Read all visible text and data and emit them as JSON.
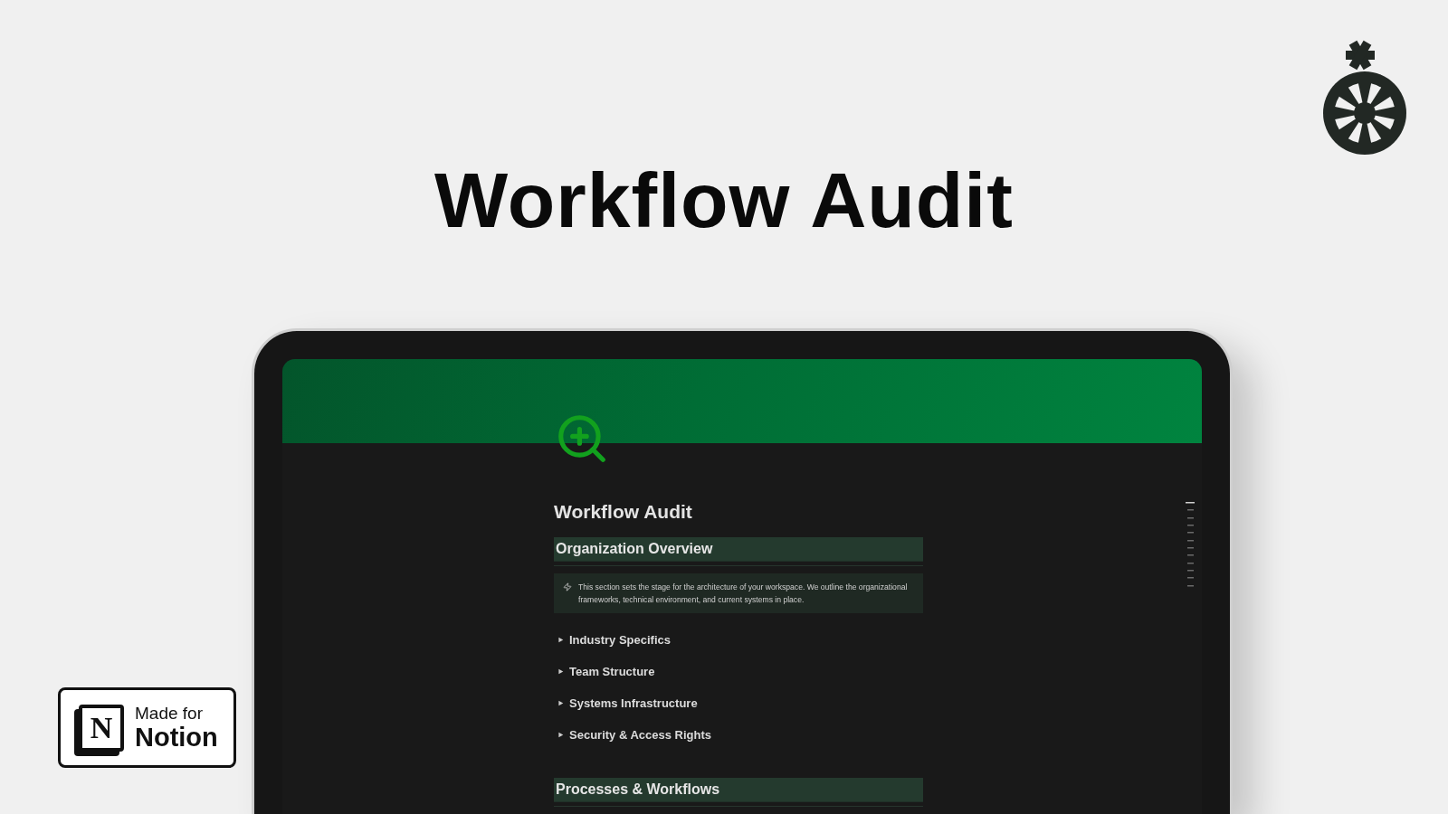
{
  "headline": "Workflow Audit",
  "page": {
    "title": "Workflow Audit",
    "sections": [
      {
        "heading": "Organization Overview",
        "callout": "This section sets the stage for the architecture of your workspace. We outline the organizational frameworks, technical environment, and current systems in place.",
        "toggles": [
          {
            "label": "Industry Specifics",
            "expanded": false
          },
          {
            "label": "Team Structure",
            "expanded": false
          },
          {
            "label": "Systems Infrastructure",
            "expanded": false
          },
          {
            "label": "Security & Access Rights",
            "expanded": false
          }
        ]
      },
      {
        "heading": "Processes & Workflows"
      }
    ]
  },
  "badge": {
    "logo_letter": "N",
    "line1": "Made for",
    "line2": "Notion"
  }
}
